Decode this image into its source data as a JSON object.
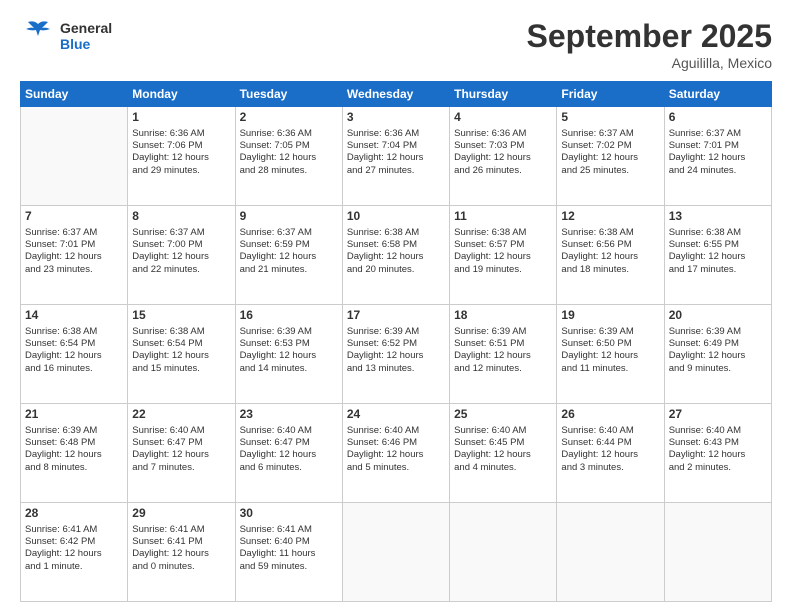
{
  "header": {
    "logo_general": "General",
    "logo_blue": "Blue",
    "month": "September 2025",
    "location": "Aguililla, Mexico"
  },
  "days_of_week": [
    "Sunday",
    "Monday",
    "Tuesday",
    "Wednesday",
    "Thursday",
    "Friday",
    "Saturday"
  ],
  "weeks": [
    [
      {
        "day": "",
        "info": ""
      },
      {
        "day": "1",
        "info": "Sunrise: 6:36 AM\nSunset: 7:06 PM\nDaylight: 12 hours\nand 29 minutes."
      },
      {
        "day": "2",
        "info": "Sunrise: 6:36 AM\nSunset: 7:05 PM\nDaylight: 12 hours\nand 28 minutes."
      },
      {
        "day": "3",
        "info": "Sunrise: 6:36 AM\nSunset: 7:04 PM\nDaylight: 12 hours\nand 27 minutes."
      },
      {
        "day": "4",
        "info": "Sunrise: 6:36 AM\nSunset: 7:03 PM\nDaylight: 12 hours\nand 26 minutes."
      },
      {
        "day": "5",
        "info": "Sunrise: 6:37 AM\nSunset: 7:02 PM\nDaylight: 12 hours\nand 25 minutes."
      },
      {
        "day": "6",
        "info": "Sunrise: 6:37 AM\nSunset: 7:01 PM\nDaylight: 12 hours\nand 24 minutes."
      }
    ],
    [
      {
        "day": "7",
        "info": "Sunrise: 6:37 AM\nSunset: 7:01 PM\nDaylight: 12 hours\nand 23 minutes."
      },
      {
        "day": "8",
        "info": "Sunrise: 6:37 AM\nSunset: 7:00 PM\nDaylight: 12 hours\nand 22 minutes."
      },
      {
        "day": "9",
        "info": "Sunrise: 6:37 AM\nSunset: 6:59 PM\nDaylight: 12 hours\nand 21 minutes."
      },
      {
        "day": "10",
        "info": "Sunrise: 6:38 AM\nSunset: 6:58 PM\nDaylight: 12 hours\nand 20 minutes."
      },
      {
        "day": "11",
        "info": "Sunrise: 6:38 AM\nSunset: 6:57 PM\nDaylight: 12 hours\nand 19 minutes."
      },
      {
        "day": "12",
        "info": "Sunrise: 6:38 AM\nSunset: 6:56 PM\nDaylight: 12 hours\nand 18 minutes."
      },
      {
        "day": "13",
        "info": "Sunrise: 6:38 AM\nSunset: 6:55 PM\nDaylight: 12 hours\nand 17 minutes."
      }
    ],
    [
      {
        "day": "14",
        "info": "Sunrise: 6:38 AM\nSunset: 6:54 PM\nDaylight: 12 hours\nand 16 minutes."
      },
      {
        "day": "15",
        "info": "Sunrise: 6:38 AM\nSunset: 6:54 PM\nDaylight: 12 hours\nand 15 minutes."
      },
      {
        "day": "16",
        "info": "Sunrise: 6:39 AM\nSunset: 6:53 PM\nDaylight: 12 hours\nand 14 minutes."
      },
      {
        "day": "17",
        "info": "Sunrise: 6:39 AM\nSunset: 6:52 PM\nDaylight: 12 hours\nand 13 minutes."
      },
      {
        "day": "18",
        "info": "Sunrise: 6:39 AM\nSunset: 6:51 PM\nDaylight: 12 hours\nand 12 minutes."
      },
      {
        "day": "19",
        "info": "Sunrise: 6:39 AM\nSunset: 6:50 PM\nDaylight: 12 hours\nand 11 minutes."
      },
      {
        "day": "20",
        "info": "Sunrise: 6:39 AM\nSunset: 6:49 PM\nDaylight: 12 hours\nand 9 minutes."
      }
    ],
    [
      {
        "day": "21",
        "info": "Sunrise: 6:39 AM\nSunset: 6:48 PM\nDaylight: 12 hours\nand 8 minutes."
      },
      {
        "day": "22",
        "info": "Sunrise: 6:40 AM\nSunset: 6:47 PM\nDaylight: 12 hours\nand 7 minutes."
      },
      {
        "day": "23",
        "info": "Sunrise: 6:40 AM\nSunset: 6:47 PM\nDaylight: 12 hours\nand 6 minutes."
      },
      {
        "day": "24",
        "info": "Sunrise: 6:40 AM\nSunset: 6:46 PM\nDaylight: 12 hours\nand 5 minutes."
      },
      {
        "day": "25",
        "info": "Sunrise: 6:40 AM\nSunset: 6:45 PM\nDaylight: 12 hours\nand 4 minutes."
      },
      {
        "day": "26",
        "info": "Sunrise: 6:40 AM\nSunset: 6:44 PM\nDaylight: 12 hours\nand 3 minutes."
      },
      {
        "day": "27",
        "info": "Sunrise: 6:40 AM\nSunset: 6:43 PM\nDaylight: 12 hours\nand 2 minutes."
      }
    ],
    [
      {
        "day": "28",
        "info": "Sunrise: 6:41 AM\nSunset: 6:42 PM\nDaylight: 12 hours\nand 1 minute."
      },
      {
        "day": "29",
        "info": "Sunrise: 6:41 AM\nSunset: 6:41 PM\nDaylight: 12 hours\nand 0 minutes."
      },
      {
        "day": "30",
        "info": "Sunrise: 6:41 AM\nSunset: 6:40 PM\nDaylight: 11 hours\nand 59 minutes."
      },
      {
        "day": "",
        "info": ""
      },
      {
        "day": "",
        "info": ""
      },
      {
        "day": "",
        "info": ""
      },
      {
        "day": "",
        "info": ""
      }
    ]
  ]
}
